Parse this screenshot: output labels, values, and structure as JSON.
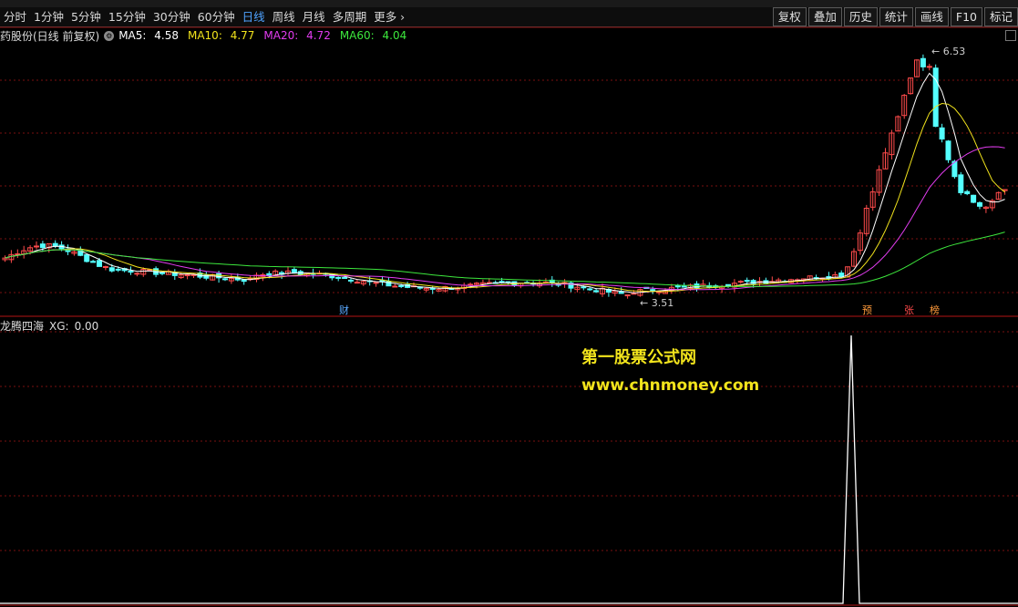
{
  "toolbar": {
    "periods": [
      "分时",
      "1分钟",
      "5分钟",
      "15分钟",
      "30分钟",
      "60分钟",
      "日线",
      "周线",
      "月线",
      "多周期",
      "更多"
    ],
    "active_period": "日线",
    "tools": [
      "复权",
      "叠加",
      "历史",
      "统计",
      "画线",
      "F10",
      "标记"
    ]
  },
  "main_panel": {
    "title": "药股份(日线 前复权)",
    "ma": [
      {
        "label": "MA5:",
        "value": "4.58",
        "color": "#ffffff"
      },
      {
        "label": "MA10:",
        "value": "4.77",
        "color": "#f2e41c"
      },
      {
        "label": "MA20:",
        "value": "4.72",
        "color": "#e23cf0"
      },
      {
        "label": "MA60:",
        "value": "4.04",
        "color": "#3de83d"
      }
    ],
    "high_label": "6.53",
    "low_label": "3.51",
    "events": [
      {
        "text": "财",
        "color": "#5aa9ff"
      },
      {
        "text": "预",
        "color": "#ff9a3a"
      },
      {
        "text": "张",
        "color": "#ff4a4a"
      },
      {
        "text": "榜",
        "color": "#ff9a3a"
      }
    ],
    "colors": {
      "up": "#ff4b4b",
      "down": "#54ffff",
      "grid": "#7a1010"
    }
  },
  "indicator_panel": {
    "name": "龙腾四海",
    "series_label": "XG:",
    "value": "0.00"
  },
  "watermark": {
    "line1": "第一股票公式网",
    "line2": "www.chnmoney.com"
  }
}
